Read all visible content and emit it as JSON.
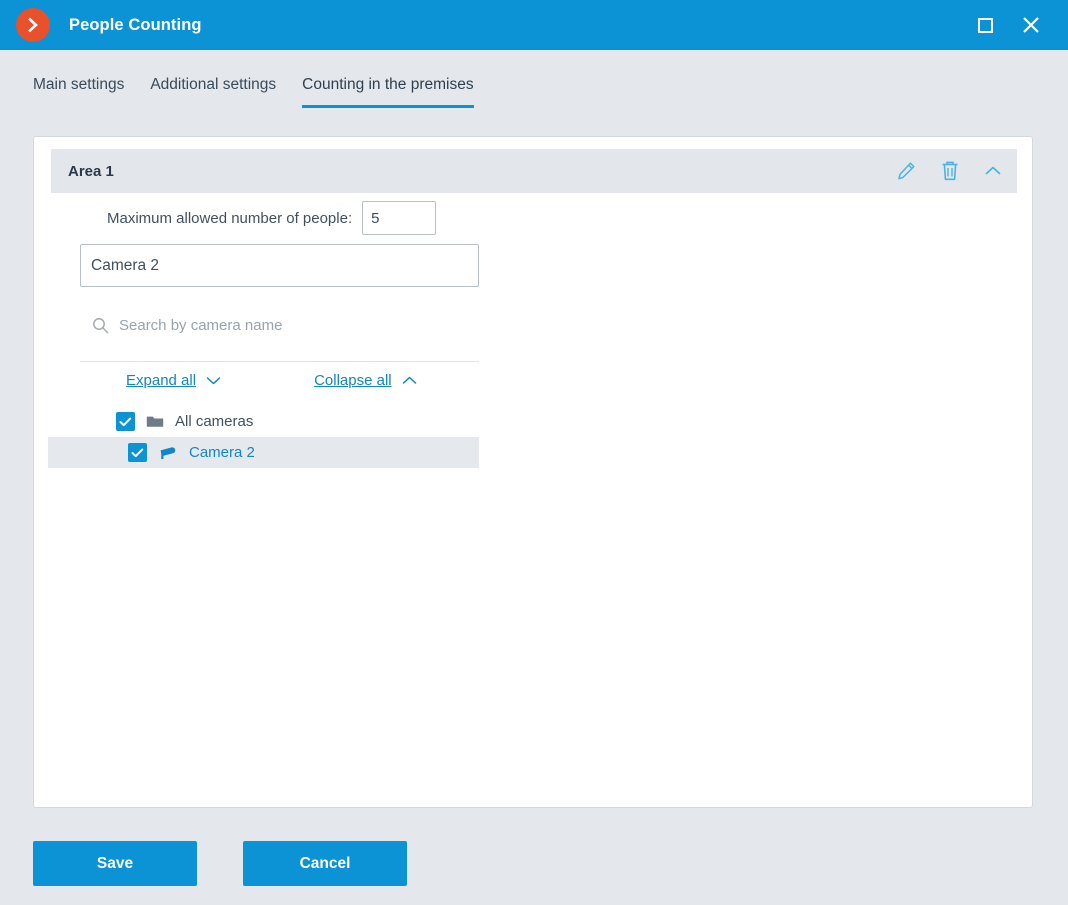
{
  "window": {
    "title": "People Counting",
    "logo_icon": "chevron-right-logo-icon",
    "maximize_icon": "maximize-icon",
    "close_icon": "close-icon",
    "close_glyph": "✕",
    "accent_color": "#0b93d5",
    "logo_color": "#e8512c"
  },
  "tabs": [
    {
      "label": "Main settings",
      "active": false
    },
    {
      "label": "Additional settings",
      "active": false
    },
    {
      "label": "Counting in the premises",
      "active": true
    }
  ],
  "area": {
    "title": "Area 1",
    "edit_icon": "pencil-icon",
    "delete_icon": "trash-icon",
    "collapse_icon": "chevron-up-icon",
    "max_people": {
      "label": "Maximum allowed number of people:",
      "value": "5"
    },
    "name_field": {
      "value": "Camera 2",
      "placeholder": ""
    },
    "search": {
      "icon": "search-icon",
      "value": "",
      "placeholder": "Search by camera name"
    },
    "expand_all": {
      "label": "Expand all",
      "icon": "chevron-down-icon"
    },
    "collapse_all": {
      "label": "Collapse all",
      "icon": "chevron-up-icon"
    },
    "tree": [
      {
        "label": "All cameras",
        "icon": "folder-icon",
        "checked": true,
        "selected": false,
        "level": 0
      },
      {
        "label": "Camera 2",
        "icon": "camera-icon",
        "checked": true,
        "selected": true,
        "level": 1
      }
    ]
  },
  "footer": {
    "save_label": "Save",
    "cancel_label": "Cancel"
  }
}
